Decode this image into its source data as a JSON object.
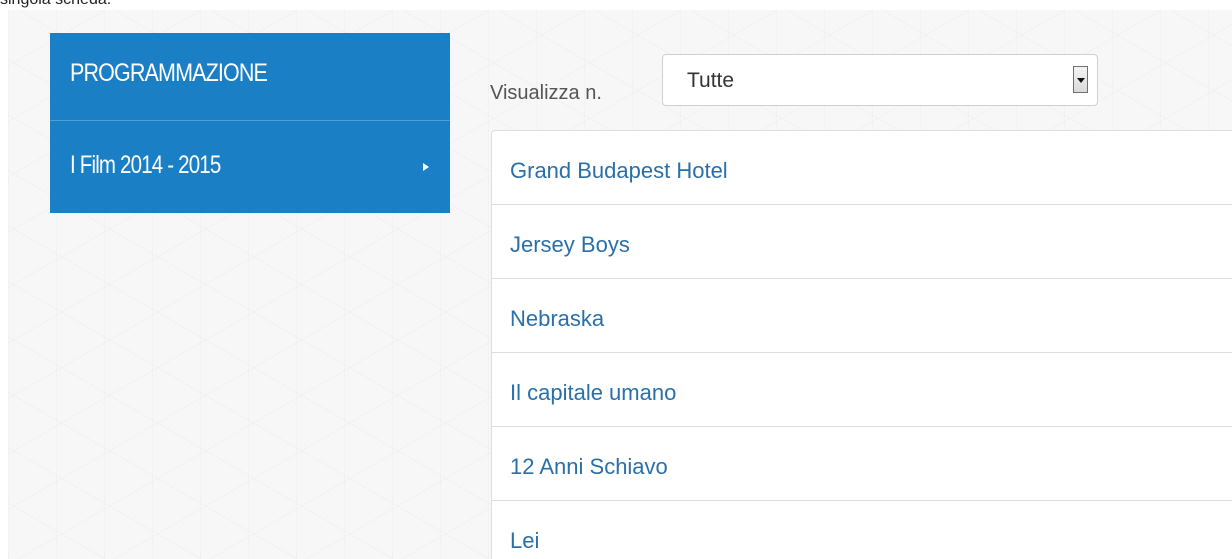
{
  "top_text": "singola scheda.",
  "sidebar": {
    "title": "PROGRAMMAZIONE",
    "items": [
      {
        "label": "I Film 2014 - 2015"
      }
    ]
  },
  "filter": {
    "label": "Visualizza n.",
    "selected": "Tutte"
  },
  "films": [
    {
      "title": "Grand Budapest Hotel"
    },
    {
      "title": "Jersey Boys"
    },
    {
      "title": "Nebraska"
    },
    {
      "title": "Il capitale umano"
    },
    {
      "title": "12 Anni Schiavo"
    },
    {
      "title": "Lei"
    }
  ],
  "colors": {
    "sidebar_bg": "#1a7fc4",
    "link": "#2a6fa8"
  }
}
